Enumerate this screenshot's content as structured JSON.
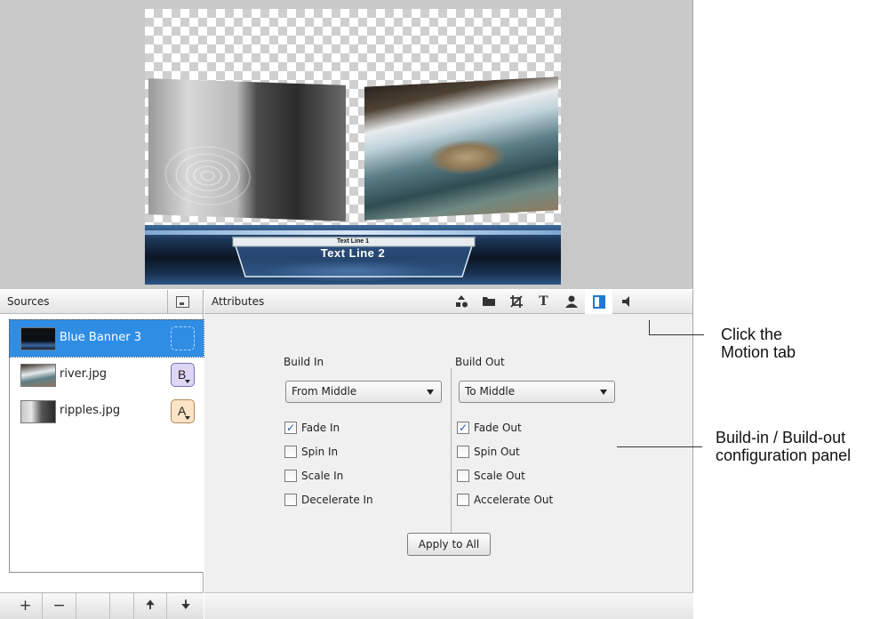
{
  "preview": {
    "banner_line1": "Text Line 1",
    "banner_line2": "Text Line 2"
  },
  "sources": {
    "title": "Sources",
    "items": [
      {
        "label": "Blue Banner 3",
        "badge": "",
        "selected": true
      },
      {
        "label": "river.jpg",
        "badge": "B"
      },
      {
        "label": "ripples.jpg",
        "badge": "A"
      }
    ],
    "toolbar": {
      "add": "+",
      "remove": "−",
      "up": "🠉",
      "down": "🠋"
    }
  },
  "attributes": {
    "title": "Attributes",
    "tabs": [
      "layer-icon",
      "folder-icon",
      "crop-icon",
      "text-icon",
      "person-icon",
      "motion-icon",
      "audio-icon"
    ],
    "tab_glyphs": {
      "text": "T"
    },
    "build_in": {
      "label": "Build In",
      "selected": "From Middle",
      "options": [
        {
          "label": "Fade In",
          "checked": true
        },
        {
          "label": "Spin In",
          "checked": false
        },
        {
          "label": "Scale In",
          "checked": false
        },
        {
          "label": "Decelerate In",
          "checked": false
        }
      ]
    },
    "build_out": {
      "label": "Build Out",
      "selected": "To Middle",
      "options": [
        {
          "label": "Fade Out",
          "checked": true
        },
        {
          "label": "Spin Out",
          "checked": false
        },
        {
          "label": "Scale Out",
          "checked": false
        },
        {
          "label": "Accelerate Out",
          "checked": false
        }
      ]
    },
    "apply_label": "Apply to All"
  },
  "callouts": {
    "motion_line1": "Click the",
    "motion_line2": "Motion tab",
    "build_line1": "Build-in / Build-out",
    "build_line2": "configuration panel"
  },
  "colors": {
    "selection": "#2f8de4",
    "motion_tab": "#1e78d6"
  }
}
